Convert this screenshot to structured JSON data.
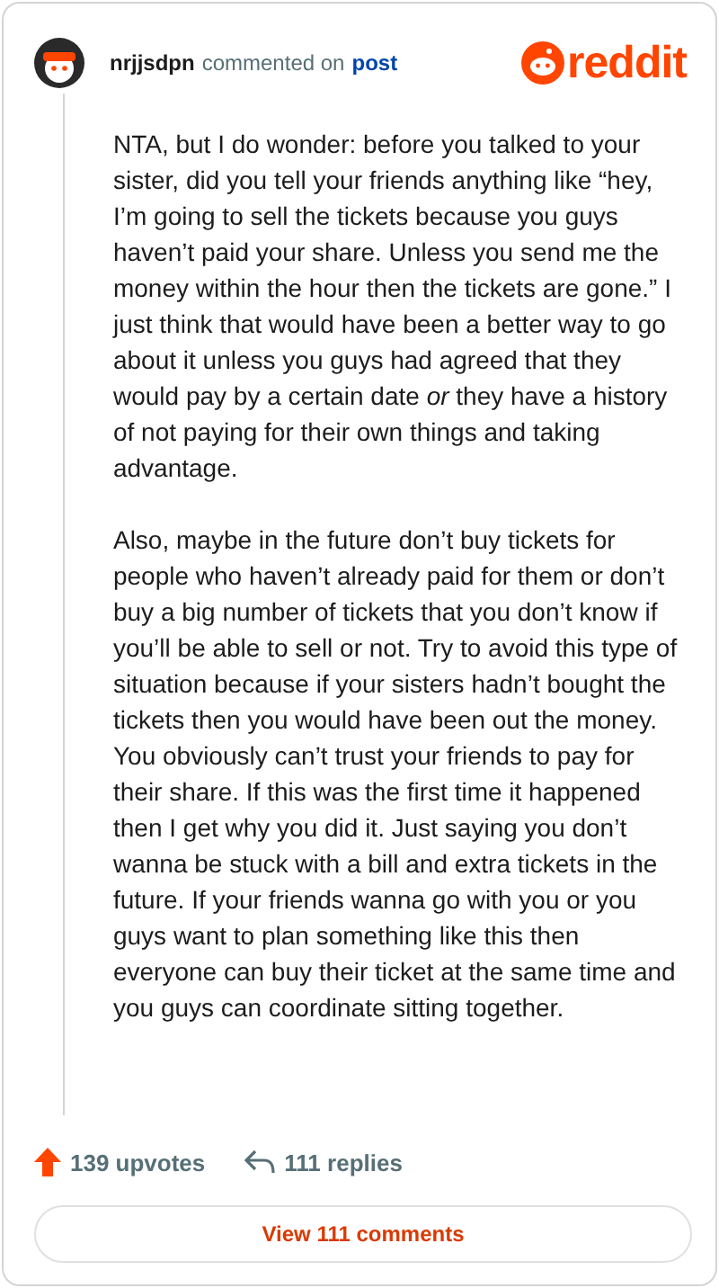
{
  "comment": {
    "author": "nrjjsdpn",
    "action": "commented on",
    "target": "post",
    "paragraphs": [
      "NTA, but I do wonder: before you talked to your sister, did you tell your friends anything like “hey, I’m going to sell the tickets because you guys haven’t paid your share. Unless you send me the money within the hour then the tickets are gone.” I just think that would have been a better way to go about it unless you guys had agreed that they would pay by a certain date *or* they have a history of not paying for their own things and taking advantage.",
      "Also, maybe in the future don’t buy tickets for people who haven’t already paid for them or don’t buy a big number of tickets that you don’t know if you’ll be able to sell or not. Try to avoid this type of situation because if your sisters hadn’t bought the tickets then you would have been out the money. You obviously can’t trust your friends to pay for their share. If this was the first time it happened then I get why you did it. Just saying you don’t wanna be stuck with a bill and extra tickets in the future. If your friends wanna go with you or you guys want to plan something like this then everyone can buy their ticket at the same time and you guys can coordinate sitting together."
    ]
  },
  "logo": {
    "text": "reddit"
  },
  "footer": {
    "upvotes": "139 upvotes",
    "replies": "111 replies",
    "button": "View 111 comments"
  }
}
